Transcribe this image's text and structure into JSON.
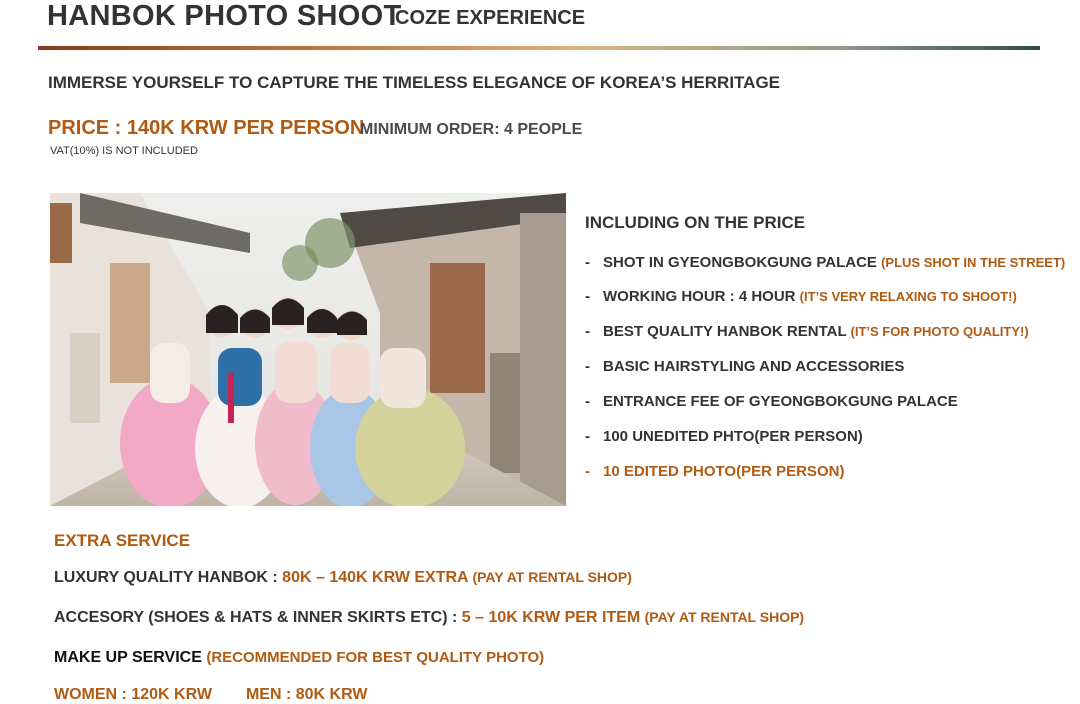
{
  "header": {
    "title": "HANBOK PHOTO SHOOT",
    "subtitle": "COZE EXPERIENCE",
    "tagline": "IMMERSE YOURSELF TO CAPTURE THE TIMELESS ELEGANCE OF KOREA’S HERRITAGE"
  },
  "pricing": {
    "price": "PRICE : 140K KRW PER PERSON",
    "minimum_order": "MINIMUM ORDER: 4 PEOPLE",
    "vat_note": "VAT(10%) IS NOT INCLUDED"
  },
  "including": {
    "heading": "INCLUDING ON THE PRICE",
    "dash": "-",
    "items": [
      {
        "text": "SHOT IN GYEONGBOKGUNG PALACE",
        "note": "(PLUS SHOT IN THE STREET)"
      },
      {
        "text": "WORKING HOUR : 4 HOUR",
        "note": "(IT’S VERY RELAXING TO SHOOT!)"
      },
      {
        "text": "BEST QUALITY HANBOK RENTAL",
        "note": "(IT’S FOR PHOTO QUALITY!)"
      },
      {
        "text": "BASIC HAIRSTYLING AND ACCESSORIES",
        "note": ""
      },
      {
        "text": "ENTRANCE FEE OF GYEONGBOKGUNG PALACE",
        "note": ""
      },
      {
        "text": "100 UNEDITED PHTO(PER PERSON)",
        "note": ""
      },
      {
        "text": "10 EDITED PHOTO(PER PERSON)",
        "note": ""
      }
    ]
  },
  "extra": {
    "heading": "EXTRA SERVICE",
    "luxury": {
      "label": "LUXURY QUALITY HANBOK :",
      "value": "80K – 140K KRW EXTRA",
      "note": "(PAY AT RENTAL SHOP)"
    },
    "accessory": {
      "label": "ACCESORY (SHOES & HATS & INNER SKIRTS ETC) :",
      "value": "5 – 10K KRW PER ITEM",
      "note": "(PAY AT RENTAL SHOP)"
    },
    "makeup": {
      "label": "MAKE UP SERVICE",
      "note": "(RECOMMENDED FOR BEST QUALITY PHOTO)"
    },
    "women_price": "WOMEN : 120K KRW",
    "men_price": "MEN : 80K KRW"
  },
  "colors": {
    "accent": "#b05a12",
    "text": "#333333"
  }
}
